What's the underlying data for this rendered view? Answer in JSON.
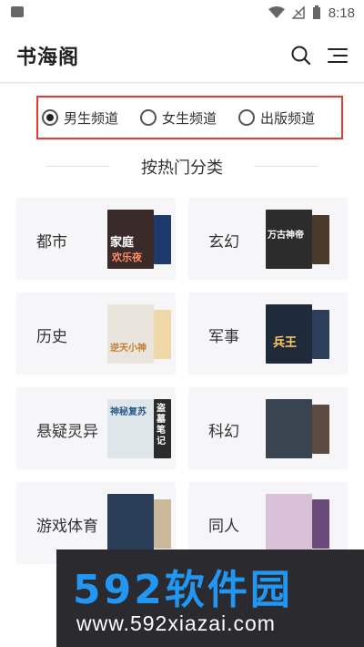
{
  "status_bar": {
    "time": "8:18"
  },
  "app": {
    "title": "书海阁"
  },
  "channels": [
    {
      "label": "男生频道",
      "selected": true
    },
    {
      "label": "女生频道",
      "selected": false
    },
    {
      "label": "出版频道",
      "selected": false
    }
  ],
  "section": {
    "title": "按热门分类"
  },
  "categories": [
    {
      "label": "都市",
      "cover_text_1": "家庭",
      "cover_text_2": "欢乐夜"
    },
    {
      "label": "玄幻",
      "cover_text_1": "万古神帝",
      "cover_text_2": ""
    },
    {
      "label": "历史",
      "cover_text_1": "逆天小神",
      "cover_text_2": ""
    },
    {
      "label": "军事",
      "cover_text_1": "兵王",
      "cover_text_2": ""
    },
    {
      "label": "悬疑灵异",
      "cover_text_1": "神秘复苏",
      "cover_text_2": "盗墓笔记"
    },
    {
      "label": "科幻",
      "cover_text_1": "",
      "cover_text_2": ""
    },
    {
      "label": "游戏体育",
      "cover_text_1": "",
      "cover_text_2": ""
    },
    {
      "label": "同人",
      "cover_text_1": "",
      "cover_text_2": ""
    }
  ],
  "watermark": {
    "brand": "592软件园",
    "url": "www.592xiazai.com"
  }
}
